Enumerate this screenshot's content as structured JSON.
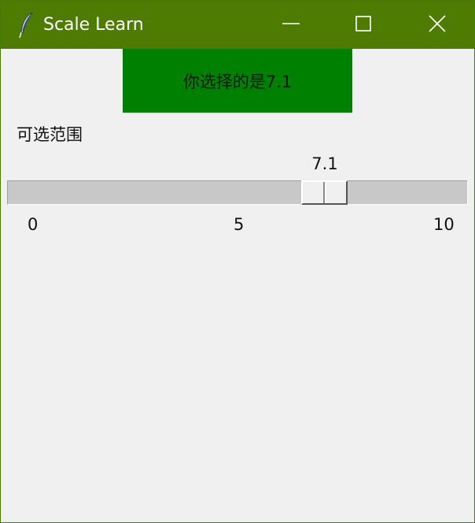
{
  "window": {
    "title": "Scale Learn",
    "icon": "feather-icon",
    "controls": [
      "minimize-icon",
      "maximize-icon",
      "close-icon"
    ]
  },
  "result": {
    "text": "你选择的是7.1"
  },
  "range_label": "可选范围",
  "scale": {
    "value_display": "7.1",
    "value": 7.1,
    "min": 0,
    "max": 10,
    "ticks": [
      "0",
      "5",
      "10"
    ]
  },
  "colors": {
    "titlebar": "#4e7c03",
    "result_background": "#008000",
    "window_background": "#f0f0f0",
    "trough": "#c8c8c8"
  }
}
